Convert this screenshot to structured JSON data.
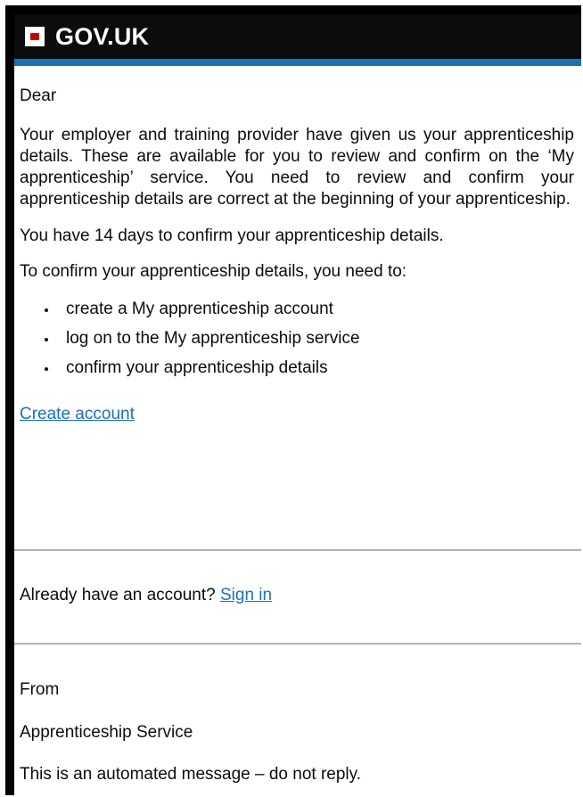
{
  "header": {
    "brand": "GOV.UK",
    "crest_icon": "crown-crest-icon",
    "accent_color": "#1d70b8",
    "bar_color": "#0b0c0c"
  },
  "email": {
    "greeting": "Dear",
    "intro": "Your employer and training provider have given us your apprenticeship details. These are available for you to review and confirm on the ‘My apprenticeship’ service. You need to review and confirm your apprenticeship details are correct at the beginning of your apprenticeship.",
    "deadline": "You have 14 days to confirm your apprenticeship details.",
    "steps_intro": "To confirm your apprenticeship details, you need to:",
    "steps": [
      "create a My apprenticeship account",
      "log on to the My apprenticeship service",
      "confirm your apprenticeship details"
    ],
    "create_account_link": "Create account",
    "already_have_account": "Already have an account?",
    "sign_in_link": "Sign in",
    "from_label": "From",
    "sender": "Apprenticeship Service",
    "automated_notice": "This is an automated message – do not reply."
  }
}
